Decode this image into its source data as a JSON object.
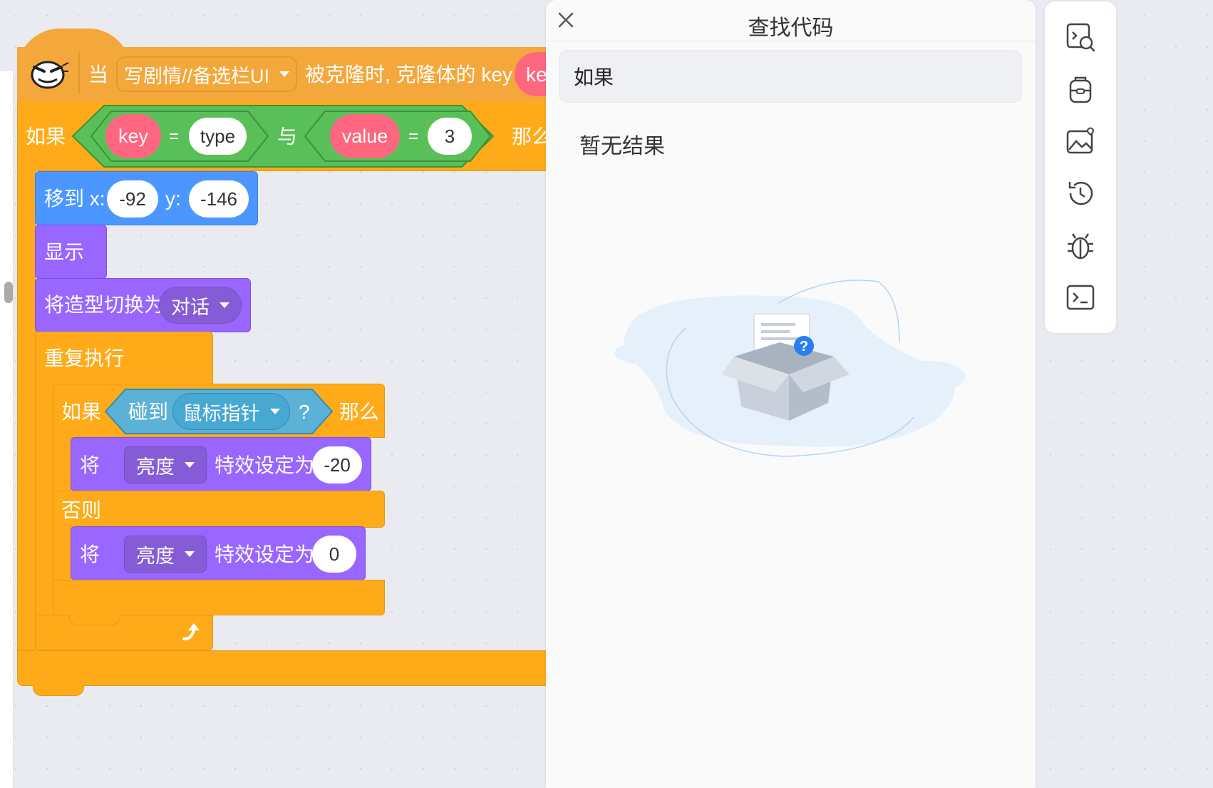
{
  "script": {
    "hat": {
      "when_label": "当",
      "sprite_dropdown": "写剧情//备选栏UI",
      "clone_text": "被克隆时, 克隆体的 key =",
      "key_partial": "ke"
    },
    "if1": {
      "if_label": "如果",
      "key": "key",
      "eq1": "=",
      "type_value": "type",
      "and_label": "与",
      "value": "value",
      "eq2": "=",
      "num": "3",
      "then_label": "那么"
    },
    "move": {
      "label": "移到 x:",
      "x": "-92",
      "y_label": "y:",
      "y": "-146"
    },
    "show": {
      "label": "显示"
    },
    "costume": {
      "label": "将造型切换为",
      "value": "对话"
    },
    "repeat": {
      "label": "重复执行"
    },
    "if2": {
      "if_label": "如果",
      "touch_label": "碰到",
      "target": "鼠标指针",
      "question": "?",
      "then_label": "那么"
    },
    "effect1": {
      "label": "将",
      "effect": "亮度",
      "set_label": "特效设定为",
      "value": "-20"
    },
    "else_label": "否则",
    "effect2": {
      "label": "将",
      "effect": "亮度",
      "set_label": "特效设定为",
      "value": "0"
    }
  },
  "find_panel": {
    "title": "查找代码",
    "search_value": "如果",
    "empty_text": "暂无结果"
  },
  "sidebar_icons": [
    "code-search-icon",
    "backpack-icon",
    "image-favorite-icon",
    "history-icon",
    "debug-bug-icon",
    "terminal-icon"
  ],
  "colors": {
    "event": "#f4a73a",
    "control": "#ffab19",
    "operator": "#59c059",
    "looks": "#9966ff",
    "motion": "#4c97ff",
    "sensing": "#5cb1d6",
    "data": "#ff6680"
  }
}
